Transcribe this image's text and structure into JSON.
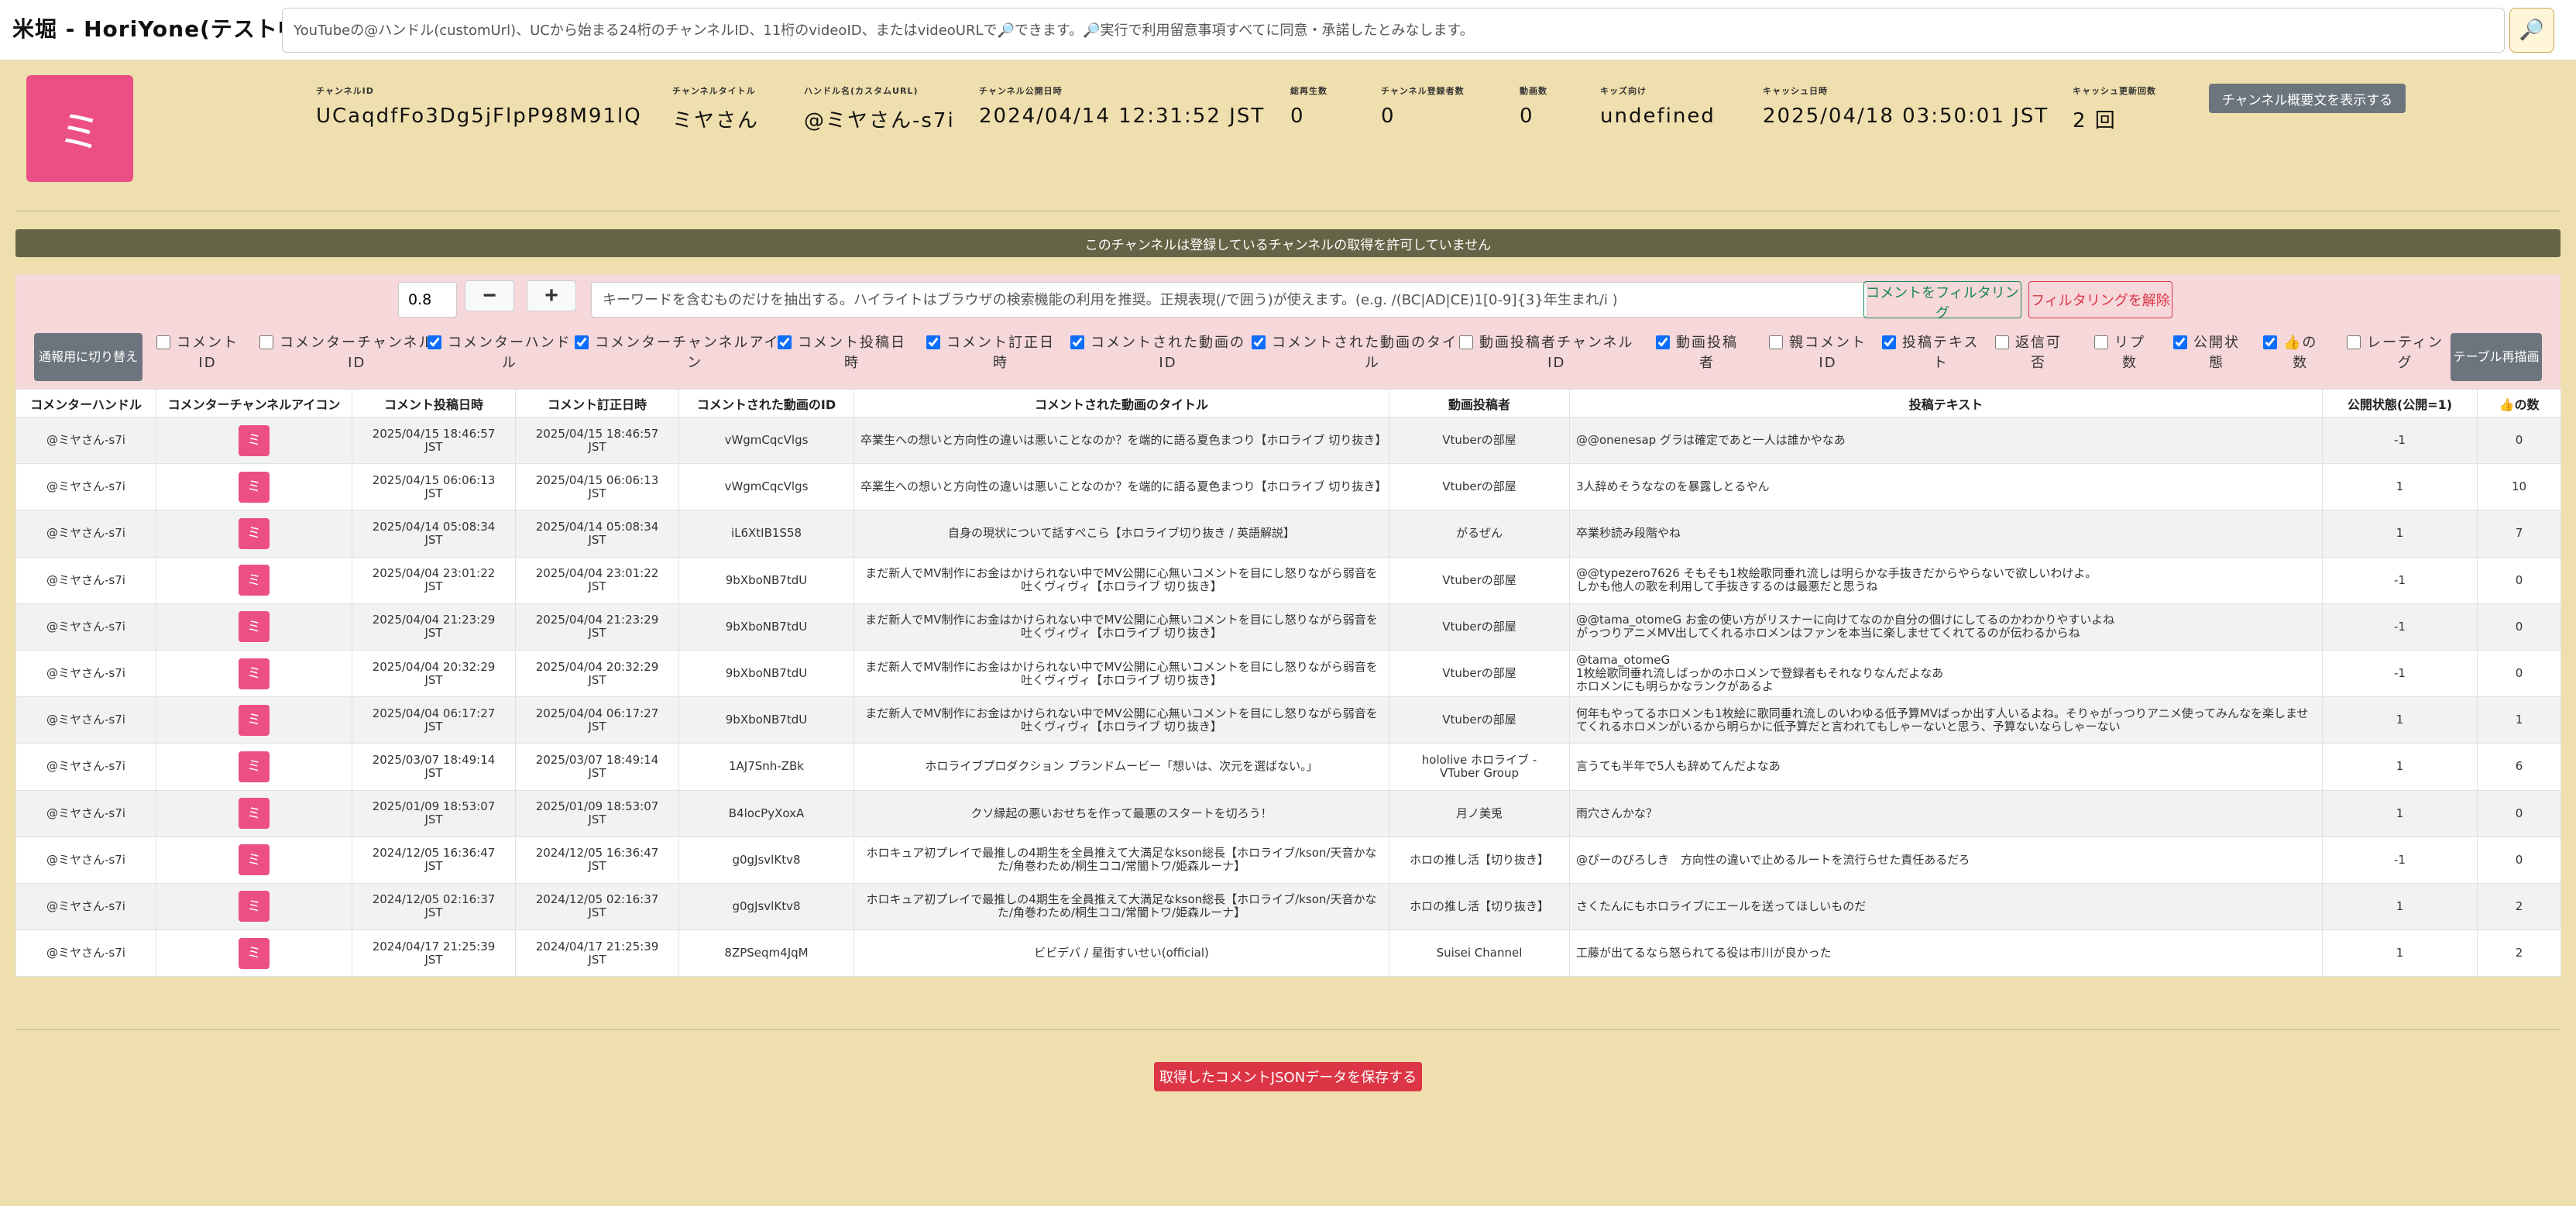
{
  "app": {
    "title": "米堀 - HoriYone(テスト中)",
    "search_placeholder": "YouTubeの@ハンドル(customUrl)、UCから始まる24桁のチャンネルID、11桁のvideoID、またはvideoURLで🔎できます。🔎実行で利用留意事項すべてに同意・承諾したとみなします。",
    "search_icon": "🔎"
  },
  "channel": {
    "avatar_char": "ミ",
    "fields": [
      {
        "label": "チャンネルID",
        "value": "UCaqdfFo3Dg5jFlpP98M91lQ"
      },
      {
        "label": "チャンネルタイトル",
        "value": "ミヤさん"
      },
      {
        "label": "ハンドル名(カスタムURL)",
        "value": "@ミヤさん-s7i"
      },
      {
        "label": "チャンネル公開日時",
        "value": "2024/04/14 12:31:52 JST"
      },
      {
        "label": "総再生数",
        "value": "0"
      },
      {
        "label": "チャンネル登録者数",
        "value": "0"
      },
      {
        "label": "動画数",
        "value": "0"
      },
      {
        "label": "キッズ向け",
        "value": "undefined"
      },
      {
        "label": "キャッシュ日時",
        "value": "2025/04/18 03:50:01 JST"
      },
      {
        "label": "キャッシュ更新回数",
        "value": "2 回"
      }
    ],
    "description_button": "チャンネル概要文を表示する"
  },
  "notice": "このチャンネルは登録しているチャンネルの取得を許可していません",
  "filter": {
    "ratio_value": "0.8",
    "minus_label": "−",
    "plus_label": "+",
    "keyword_placeholder": "キーワードを含むものだけを抽出する。ハイライトはブラウザの検索機能の利用を推奨。正規表現(/で囲う)が使えます。(e.g. /(BC|AD|CE)1[0-9]{3}年生まれ/i )",
    "filter_button": "コメントをフィルタリング",
    "clear_button": "フィルタリングを解除",
    "switch_button": "通報用に切り替え",
    "redraw_button": "テーブル再描画",
    "columns": [
      {
        "label": "コメント\nID",
        "checked": false
      },
      {
        "label": "コメンターチャンネル\nID",
        "checked": false
      },
      {
        "label": "コメンターハンド\nル",
        "checked": true
      },
      {
        "label": "コメンターチャンネルアイコ\nン",
        "checked": true
      },
      {
        "label": "コメント投稿日\n時",
        "checked": true
      },
      {
        "label": "コメント訂正日\n時",
        "checked": true
      },
      {
        "label": "コメントされた動画の\nID",
        "checked": true
      },
      {
        "label": "コメントされた動画のタイト\nル",
        "checked": true
      },
      {
        "label": "動画投稿者チャンネル\nID",
        "checked": false
      },
      {
        "label": "動画投稿\n者",
        "checked": true
      },
      {
        "label": "親コメント\nID",
        "checked": false
      },
      {
        "label": "投稿テキス\nト",
        "checked": true
      },
      {
        "label": "返信可\n否",
        "checked": false
      },
      {
        "label": "リプ\n数",
        "checked": false
      },
      {
        "label": "公開状\n態",
        "checked": true
      },
      {
        "label": "👍の\n数",
        "checked": true
      },
      {
        "label": "レーティン\nグ",
        "checked": false
      }
    ]
  },
  "table": {
    "headers": [
      "コメンターハンドル",
      "コメンターチャンネルアイコン",
      "コメント投稿日時",
      "コメント訂正日時",
      "コメントされた動画のID",
      "コメントされた動画のタイトル",
      "動画投稿者",
      "投稿テキスト",
      "公開状態(公開=1)",
      "👍の数"
    ],
    "rows": [
      {
        "handle": "@ミヤさん-s7i",
        "icon": "ミ",
        "posted": "2025/04/15 18:46:57\nJST",
        "edited": "2025/04/15 18:46:57\nJST",
        "video_id": "vWgmCqcVlgs",
        "title": "卒業生への想いと方向性の違いは悪いことなのか？を端的に語る夏色まつり【ホロライブ 切り抜き】",
        "uploader": "Vtuberの部屋",
        "text": "@@onenesap グラは確定であと一人は誰かやなあ",
        "public": "-1",
        "likes": "0"
      },
      {
        "handle": "@ミヤさん-s7i",
        "icon": "ミ",
        "posted": "2025/04/15 06:06:13\nJST",
        "edited": "2025/04/15 06:06:13\nJST",
        "video_id": "vWgmCqcVlgs",
        "title": "卒業生への想いと方向性の違いは悪いことなのか？を端的に語る夏色まつり【ホロライブ 切り抜き】",
        "uploader": "Vtuberの部屋",
        "text": "3人辞めそうななのを暴露しとるやん",
        "public": "1",
        "likes": "10"
      },
      {
        "handle": "@ミヤさん-s7i",
        "icon": "ミ",
        "posted": "2025/04/14 05:08:34\nJST",
        "edited": "2025/04/14 05:08:34\nJST",
        "video_id": "iL6XtIB1S58",
        "title": "自身の現状について話すぺこら【ホロライブ切り抜き / 英語解説】",
        "uploader": "がるぜん",
        "text": "卒業秒読み段階やね",
        "public": "1",
        "likes": "7"
      },
      {
        "handle": "@ミヤさん-s7i",
        "icon": "ミ",
        "posted": "2025/04/04 23:01:22\nJST",
        "edited": "2025/04/04 23:01:22\nJST",
        "video_id": "9bXboNB7tdU",
        "title": "まだ新人でMV制作にお金はかけられない中でMV公開に心無いコメントを目にし怒りながら弱音を吐くヴィヴィ【ホロライブ 切り抜き】",
        "uploader": "Vtuberの部屋",
        "text": "@@typezero7626 そもそも1枚絵歌同垂れ流しは明らかな手抜きだからやらないで欲しいわけよ。\nしかも他人の歌を利用して手抜きするのは最悪だと思うね",
        "public": "-1",
        "likes": "0"
      },
      {
        "handle": "@ミヤさん-s7i",
        "icon": "ミ",
        "posted": "2025/04/04 21:23:29\nJST",
        "edited": "2025/04/04 21:23:29\nJST",
        "video_id": "9bXboNB7tdU",
        "title": "まだ新人でMV制作にお金はかけられない中でMV公開に心無いコメントを目にし怒りながら弱音を吐くヴィヴィ【ホロライブ 切り抜き】",
        "uploader": "Vtuberの部屋",
        "text": "@@tama_otomeG お金の使い方がリスナーに向けてなのか自分の個けにしてるのかわかりやすいよね\nがっつりアニメMV出してくれるホロメンはファンを本当に楽しませてくれてるのが伝わるからね",
        "public": "-1",
        "likes": "0"
      },
      {
        "handle": "@ミヤさん-s7i",
        "icon": "ミ",
        "posted": "2025/04/04 20:32:29\nJST",
        "edited": "2025/04/04 20:32:29\nJST",
        "video_id": "9bXboNB7tdU",
        "title": "まだ新人でMV制作にお金はかけられない中でMV公開に心無いコメントを目にし怒りながら弱音を吐くヴィヴィ【ホロライブ 切り抜き】",
        "uploader": "Vtuberの部屋",
        "text": "@tama_otomeG\n1枚絵歌同垂れ流しばっかのホロメンで登録者もそれなりなんだよなあ\nホロメンにも明らかなランクがあるよ",
        "public": "-1",
        "likes": "0"
      },
      {
        "handle": "@ミヤさん-s7i",
        "icon": "ミ",
        "posted": "2025/04/04 06:17:27\nJST",
        "edited": "2025/04/04 06:17:27\nJST",
        "video_id": "9bXboNB7tdU",
        "title": "まだ新人でMV制作にお金はかけられない中でMV公開に心無いコメントを目にし怒りながら弱音を吐くヴィヴィ【ホロライブ 切り抜き】",
        "uploader": "Vtuberの部屋",
        "text": "何年もやってるホロメンも1枚絵に歌同垂れ流しのいわゆる低予算MVばっか出す人いるよね。そりゃがっつりアニメ使ってみんなを楽しませてくれるホロメンがいるから明らかに低予算だと言われてもしゃーないと思う、予算ないならしゃーない",
        "public": "1",
        "likes": "1"
      },
      {
        "handle": "@ミヤさん-s7i",
        "icon": "ミ",
        "posted": "2025/03/07 18:49:14\nJST",
        "edited": "2025/03/07 18:49:14\nJST",
        "video_id": "1AJ7Snh-ZBk",
        "title": "ホロライブプロダクション ブランドムービー「想いは、次元を選ばない。」",
        "uploader": "hololive ホロライブ -\nVTuber Group",
        "text": "言うても半年で5人も辞めてんだよなあ",
        "public": "1",
        "likes": "6"
      },
      {
        "handle": "@ミヤさん-s7i",
        "icon": "ミ",
        "posted": "2025/01/09 18:53:07\nJST",
        "edited": "2025/01/09 18:53:07\nJST",
        "video_id": "B4locPyXoxA",
        "title": "クソ縁起の悪いおせちを作って最悪のスタートを切ろう！",
        "uploader": "月ノ美兎",
        "text": "雨穴さんかな？",
        "public": "1",
        "likes": "0"
      },
      {
        "handle": "@ミヤさん-s7i",
        "icon": "ミ",
        "posted": "2024/12/05 16:36:47\nJST",
        "edited": "2024/12/05 16:36:47\nJST",
        "video_id": "g0gJsvlKtv8",
        "title": "ホロキュア初プレイで最推しの4期生を全員推えて大満足なkson総長【ホロライブ/kson/天音かなた/角巻わため/桐生ココ/常闇トワ/姫森ルーナ】",
        "uploader": "ホロの推し活【切り抜き】",
        "text": "@ぴーのびろしき　方向性の違いで止めるルートを流行らせた責任あるだろ",
        "public": "-1",
        "likes": "0"
      },
      {
        "handle": "@ミヤさん-s7i",
        "icon": "ミ",
        "posted": "2024/12/05 02:16:37\nJST",
        "edited": "2024/12/05 02:16:37\nJST",
        "video_id": "g0gJsvlKtv8",
        "title": "ホロキュア初プレイで最推しの4期生を全員推えて大満足なkson総長【ホロライブ/kson/天音かなた/角巻わため/桐生ココ/常闇トワ/姫森ルーナ】",
        "uploader": "ホロの推し活【切り抜き】",
        "text": "さくたんにもホロライブにエールを送ってほしいものだ",
        "public": "1",
        "likes": "2"
      },
      {
        "handle": "@ミヤさん-s7i",
        "icon": "ミ",
        "posted": "2024/04/17 21:25:39\nJST",
        "edited": "2024/04/17 21:25:39\nJST",
        "video_id": "8ZPSeqm4JqM",
        "title": "ビビデバ / 星街すいせい(official)",
        "uploader": "Suisei Channel",
        "text": "工藤が出てるなら怒られてる役は市川が良かった",
        "public": "1",
        "likes": "2"
      }
    ]
  },
  "save_button": "取得したコメントJSONデータを保存する",
  "colors": {
    "background": "#efdfae",
    "avatar": "#ec4f86",
    "notice": "#656446",
    "filter_panel": "#f6d7da",
    "danger": "#dc3545",
    "success": "#198754",
    "secondary": "#6c757d"
  }
}
